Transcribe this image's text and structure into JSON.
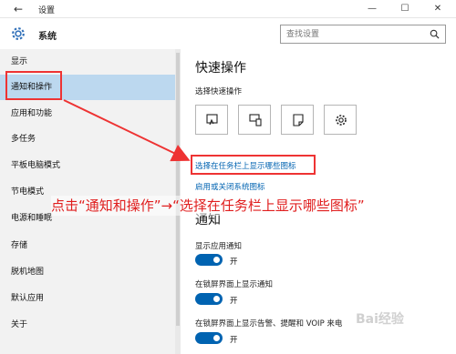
{
  "window": {
    "title": "设置",
    "back": "←",
    "min": "—",
    "max": "☐",
    "close": "✕"
  },
  "header": {
    "title": "系统",
    "search_placeholder": "查找设置"
  },
  "sidebar": {
    "items": [
      {
        "label": "显示"
      },
      {
        "label": "通知和操作"
      },
      {
        "label": "应用和功能"
      },
      {
        "label": "多任务"
      },
      {
        "label": "平板电脑模式"
      },
      {
        "label": "节电模式"
      },
      {
        "label": "电源和睡眠"
      },
      {
        "label": "存储"
      },
      {
        "label": "脱机地图"
      },
      {
        "label": "默认应用"
      },
      {
        "label": "关于"
      }
    ],
    "active_index": 1
  },
  "main": {
    "quick_actions_title": "快速操作",
    "choose_label": "选择快速操作",
    "tiles": [
      "tablet-mode-icon",
      "connect-icon",
      "note-icon",
      "settings-icon"
    ],
    "link_taskbar": "选择在任务栏上显示哪些图标",
    "link_system_icons": "启用或关闭系统图标",
    "notify_title": "通知",
    "toggles": [
      {
        "label": "显示应用通知",
        "state": "开"
      },
      {
        "label": "在锁屏界面上显示通知",
        "state": "开"
      },
      {
        "label": "在锁屏界面上显示告警、提醒和 VOIP 来电",
        "state": "开"
      }
    ]
  },
  "annotation": "点击“通知和操作”→“选择在任务栏上显示哪些图标”",
  "watermark": "Bai经验",
  "colors": {
    "accent": "#0063b1",
    "highlight": "#e33333",
    "sidebar_active": "#bcd8ef"
  }
}
